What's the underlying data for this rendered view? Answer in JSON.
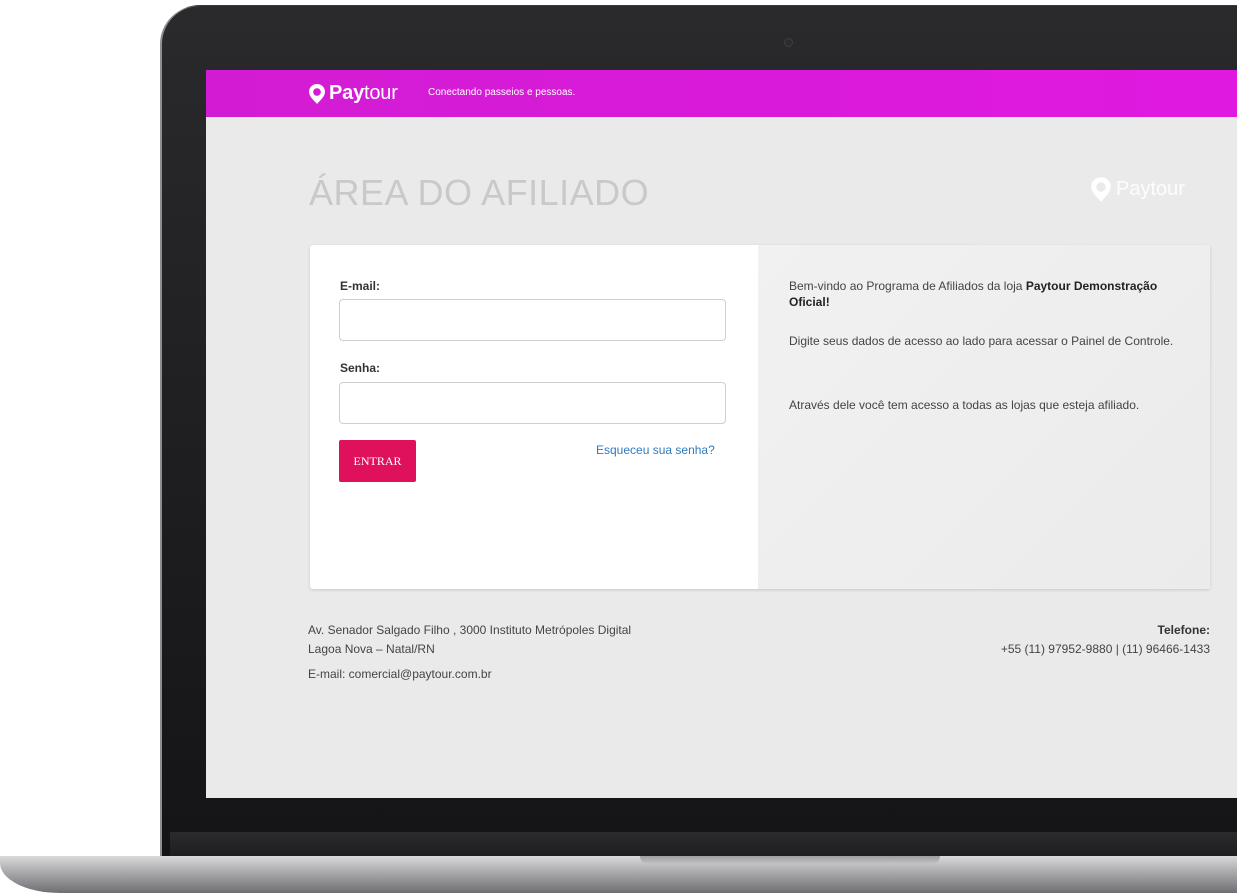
{
  "header": {
    "brand_pay": "Pay",
    "brand_tour": "tour",
    "tagline": "Conectando passeios e pessoas."
  },
  "page": {
    "title": "ÁREA DO AFILIADO",
    "watermark": "Paytour"
  },
  "login": {
    "email_label": "E-mail:",
    "email_value": "",
    "password_label": "Senha:",
    "password_value": "",
    "submit_label": "ENTRAR",
    "forgot_label": "Esqueceu sua senha?"
  },
  "info": {
    "p1_text": "Bem-vindo ao Programa de Afiliados da loja ",
    "p1_bold": "Paytour Demonstração Oficial",
    "p1_end": "!",
    "p2": "Digite seus dados de acesso ao lado para acessar o Painel de Controle.",
    "p3": "Através dele você tem acesso a todas as lojas que esteja afiliado."
  },
  "footer": {
    "address_line1": "Av. Senador Salgado Filho , 3000 Instituto Metrópoles Digital",
    "address_line2": "Lagoa Nova – Natal/RN",
    "email": "E-mail: comercial@paytour.com.br",
    "phone_label": "Telefone:",
    "phone_numbers": "+55 (11) 97952-9880 | (11) 96466-1433"
  },
  "colors": {
    "brand_magenta": "#e019e0",
    "button_pink": "#e0115c",
    "link_blue": "#2e7bbf"
  },
  "icons": {
    "brand": "location-pin-logo",
    "watermark": "location-pin-logo"
  }
}
